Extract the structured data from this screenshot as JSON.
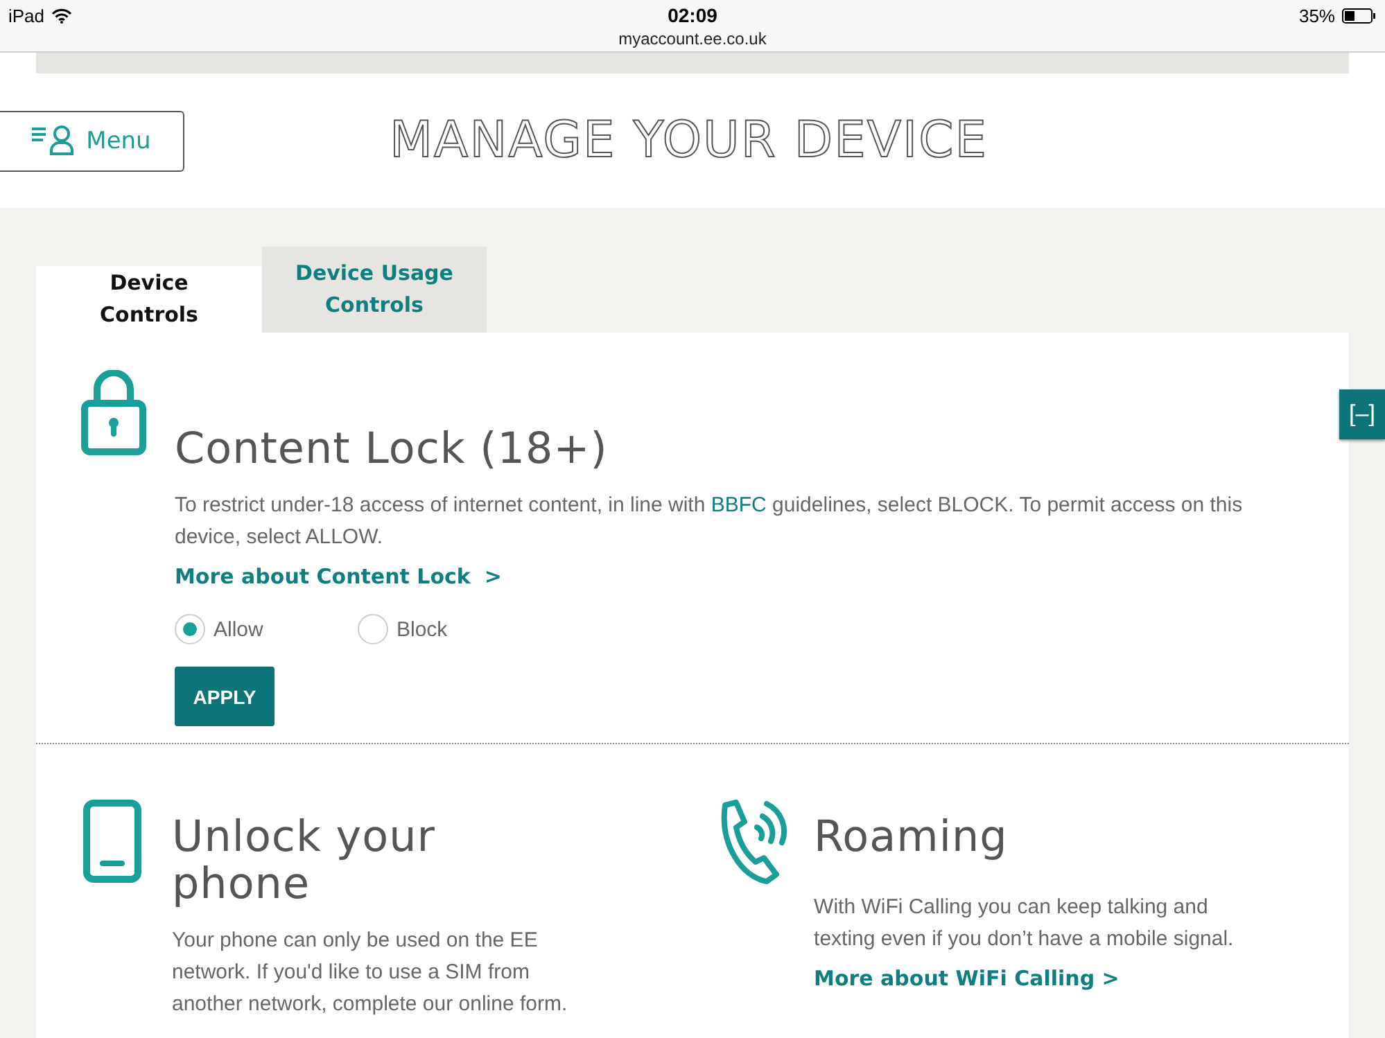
{
  "status_bar": {
    "device": "iPad",
    "time": "02:09",
    "battery": "35%",
    "url": "myaccount.ee.co.uk"
  },
  "header": {
    "menu_label": "Menu",
    "title": "MANAGE YOUR DEVICE"
  },
  "tabs": [
    {
      "label": "Device Controls",
      "selected": true
    },
    {
      "label": "Device Usage Controls",
      "selected": false
    }
  ],
  "side_button": {
    "label": "[–]"
  },
  "content_lock": {
    "title": "Content Lock (18+)",
    "text_before": "To restrict under-18 access of internet content, in line with",
    "text_link": "BBFC",
    "text_after": "guidelines, select BLOCK. To permit access on this device, select ALLOW.",
    "more_link": "More about Content Lock",
    "more_chevron": ">",
    "options": [
      {
        "label": "Allow",
        "selected": true
      },
      {
        "label": "Block",
        "selected": false
      }
    ],
    "apply": "APPLY"
  },
  "sections": [
    {
      "kind": "phone",
      "title": "Unlock your phone",
      "text": "Your phone can only be used on the EE network. If you'd like to use a SIM from another network, complete our online form."
    },
    {
      "kind": "wifi-call",
      "title": "Roaming",
      "text": "With WiFi Calling you can keep talking and texting even if you don’t have a mobile signal.",
      "link": "More about WiFi Calling >"
    }
  ]
}
